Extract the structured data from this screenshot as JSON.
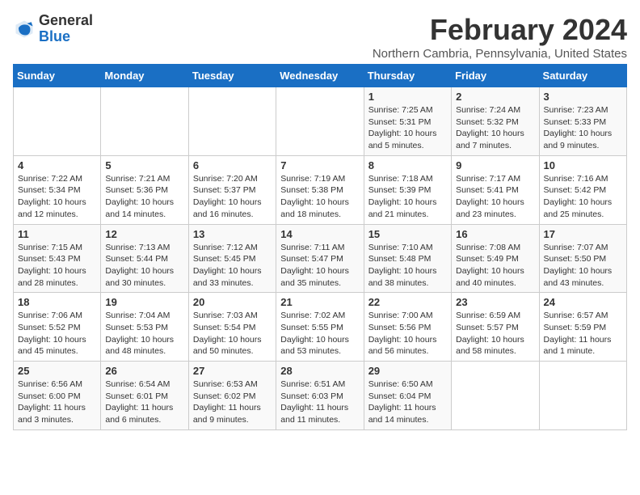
{
  "logo": {
    "general": "General",
    "blue": "Blue"
  },
  "title": "February 2024",
  "subtitle": "Northern Cambria, Pennsylvania, United States",
  "days_of_week": [
    "Sunday",
    "Monday",
    "Tuesday",
    "Wednesday",
    "Thursday",
    "Friday",
    "Saturday"
  ],
  "weeks": [
    [
      {
        "day": "",
        "info": ""
      },
      {
        "day": "",
        "info": ""
      },
      {
        "day": "",
        "info": ""
      },
      {
        "day": "",
        "info": ""
      },
      {
        "day": "1",
        "info": "Sunrise: 7:25 AM\nSunset: 5:31 PM\nDaylight: 10 hours\nand 5 minutes."
      },
      {
        "day": "2",
        "info": "Sunrise: 7:24 AM\nSunset: 5:32 PM\nDaylight: 10 hours\nand 7 minutes."
      },
      {
        "day": "3",
        "info": "Sunrise: 7:23 AM\nSunset: 5:33 PM\nDaylight: 10 hours\nand 9 minutes."
      }
    ],
    [
      {
        "day": "4",
        "info": "Sunrise: 7:22 AM\nSunset: 5:34 PM\nDaylight: 10 hours\nand 12 minutes."
      },
      {
        "day": "5",
        "info": "Sunrise: 7:21 AM\nSunset: 5:36 PM\nDaylight: 10 hours\nand 14 minutes."
      },
      {
        "day": "6",
        "info": "Sunrise: 7:20 AM\nSunset: 5:37 PM\nDaylight: 10 hours\nand 16 minutes."
      },
      {
        "day": "7",
        "info": "Sunrise: 7:19 AM\nSunset: 5:38 PM\nDaylight: 10 hours\nand 18 minutes."
      },
      {
        "day": "8",
        "info": "Sunrise: 7:18 AM\nSunset: 5:39 PM\nDaylight: 10 hours\nand 21 minutes."
      },
      {
        "day": "9",
        "info": "Sunrise: 7:17 AM\nSunset: 5:41 PM\nDaylight: 10 hours\nand 23 minutes."
      },
      {
        "day": "10",
        "info": "Sunrise: 7:16 AM\nSunset: 5:42 PM\nDaylight: 10 hours\nand 25 minutes."
      }
    ],
    [
      {
        "day": "11",
        "info": "Sunrise: 7:15 AM\nSunset: 5:43 PM\nDaylight: 10 hours\nand 28 minutes."
      },
      {
        "day": "12",
        "info": "Sunrise: 7:13 AM\nSunset: 5:44 PM\nDaylight: 10 hours\nand 30 minutes."
      },
      {
        "day": "13",
        "info": "Sunrise: 7:12 AM\nSunset: 5:45 PM\nDaylight: 10 hours\nand 33 minutes."
      },
      {
        "day": "14",
        "info": "Sunrise: 7:11 AM\nSunset: 5:47 PM\nDaylight: 10 hours\nand 35 minutes."
      },
      {
        "day": "15",
        "info": "Sunrise: 7:10 AM\nSunset: 5:48 PM\nDaylight: 10 hours\nand 38 minutes."
      },
      {
        "day": "16",
        "info": "Sunrise: 7:08 AM\nSunset: 5:49 PM\nDaylight: 10 hours\nand 40 minutes."
      },
      {
        "day": "17",
        "info": "Sunrise: 7:07 AM\nSunset: 5:50 PM\nDaylight: 10 hours\nand 43 minutes."
      }
    ],
    [
      {
        "day": "18",
        "info": "Sunrise: 7:06 AM\nSunset: 5:52 PM\nDaylight: 10 hours\nand 45 minutes."
      },
      {
        "day": "19",
        "info": "Sunrise: 7:04 AM\nSunset: 5:53 PM\nDaylight: 10 hours\nand 48 minutes."
      },
      {
        "day": "20",
        "info": "Sunrise: 7:03 AM\nSunset: 5:54 PM\nDaylight: 10 hours\nand 50 minutes."
      },
      {
        "day": "21",
        "info": "Sunrise: 7:02 AM\nSunset: 5:55 PM\nDaylight: 10 hours\nand 53 minutes."
      },
      {
        "day": "22",
        "info": "Sunrise: 7:00 AM\nSunset: 5:56 PM\nDaylight: 10 hours\nand 56 minutes."
      },
      {
        "day": "23",
        "info": "Sunrise: 6:59 AM\nSunset: 5:57 PM\nDaylight: 10 hours\nand 58 minutes."
      },
      {
        "day": "24",
        "info": "Sunrise: 6:57 AM\nSunset: 5:59 PM\nDaylight: 11 hours\nand 1 minute."
      }
    ],
    [
      {
        "day": "25",
        "info": "Sunrise: 6:56 AM\nSunset: 6:00 PM\nDaylight: 11 hours\nand 3 minutes."
      },
      {
        "day": "26",
        "info": "Sunrise: 6:54 AM\nSunset: 6:01 PM\nDaylight: 11 hours\nand 6 minutes."
      },
      {
        "day": "27",
        "info": "Sunrise: 6:53 AM\nSunset: 6:02 PM\nDaylight: 11 hours\nand 9 minutes."
      },
      {
        "day": "28",
        "info": "Sunrise: 6:51 AM\nSunset: 6:03 PM\nDaylight: 11 hours\nand 11 minutes."
      },
      {
        "day": "29",
        "info": "Sunrise: 6:50 AM\nSunset: 6:04 PM\nDaylight: 11 hours\nand 14 minutes."
      },
      {
        "day": "",
        "info": ""
      },
      {
        "day": "",
        "info": ""
      }
    ]
  ]
}
